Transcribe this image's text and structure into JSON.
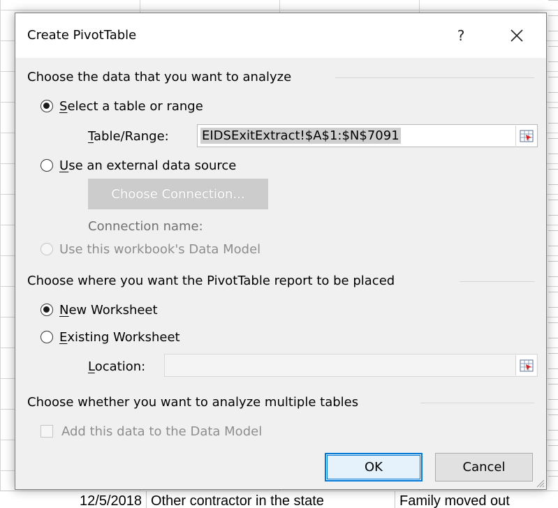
{
  "sheet": {
    "bottom_row": [
      "12/5/2018",
      "Other contractor in the state",
      "Family moved out"
    ]
  },
  "dialog": {
    "title": "Create PivotTable",
    "help_glyph": "?",
    "close_glyph": "✕",
    "section1": {
      "header": "Choose the data that you want to analyze",
      "radio_select_table": {
        "first": "S",
        "rest": "elect a table or range",
        "checked": true
      },
      "table_range_label": "Table/Range:",
      "table_range_value": "EIDSExitExtract!$A$1:$N$7091",
      "radio_external": {
        "first": "U",
        "rest": "se an external data source",
        "checked": false
      },
      "choose_connection_label": "Choose Connection...",
      "connection_name_label": "Connection name:",
      "radio_data_model": {
        "label": "Use this workbook's Data Model",
        "enabled": false
      }
    },
    "section2": {
      "header": "Choose where you want the PivotTable report to be placed",
      "radio_new_worksheet": {
        "first": "N",
        "rest": "ew Worksheet",
        "checked": true
      },
      "radio_existing_worksheet": {
        "first": "E",
        "rest": "xisting Worksheet",
        "checked": false
      },
      "location_label": "Location:",
      "location_value": ""
    },
    "section3": {
      "header": "Choose whether you want to analyze multiple tables",
      "checkbox_data_model": {
        "label": "Add this data to the Data Model",
        "checked": false,
        "enabled": false
      }
    },
    "buttons": {
      "ok": "OK",
      "cancel": "Cancel"
    },
    "colors": {
      "accent": "#0078d7",
      "dialog_bg": "#f0f0f0",
      "disabled_text": "#8d8d8d"
    }
  }
}
